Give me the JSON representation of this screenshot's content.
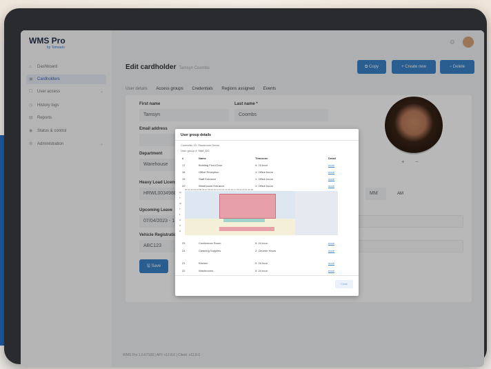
{
  "app": {
    "logo": "WMS Pro",
    "logo_sub": "by Tomaato"
  },
  "sidebar": {
    "collapse": "«",
    "items": [
      {
        "label": "Dashboard",
        "icon": "home-icon"
      },
      {
        "label": "Cardholders",
        "icon": "cardholder-icon"
      },
      {
        "label": "User access",
        "icon": "user-access-icon"
      },
      {
        "label": "History logs",
        "icon": "history-icon"
      },
      {
        "label": "Reports",
        "icon": "reports-icon"
      },
      {
        "label": "Status & control",
        "icon": "status-icon"
      },
      {
        "label": "Administration",
        "icon": "admin-icon"
      }
    ]
  },
  "header": {
    "title": "Edit cardholder",
    "subtitle": "Tamsyn Coombs",
    "copy": "Copy",
    "create": "+ Create new",
    "delete": "− Delete"
  },
  "tabs": [
    "User details",
    "Access groups",
    "Credentials",
    "Regions assigned",
    "Events"
  ],
  "form": {
    "first_name_label": "First name",
    "first_name": "Tamsyn",
    "last_name_label": "Last name *",
    "last_name": "Coombs",
    "email_label": "Email address",
    "department_label": "Department",
    "department": "Warehouse",
    "license_label": "Heavy Load Licens",
    "license": "HRWL0034988",
    "leave_label": "Upcoming Leave",
    "leave": "07/04/2023 - 1",
    "vehicle_label": "Vehicle Registratio",
    "vehicle": "ABC123",
    "time_mm": "MM",
    "time_ampm": "AM",
    "save": "Save",
    "plus": "+",
    "minus": "−"
  },
  "footer": "WMS Pro 1.0.67109 | API: v12.8.0 | Client: v12.8.0",
  "modal": {
    "title": "User group details",
    "controller": "Controller 10: Showroom Demo",
    "user_group": "User group 4: Staff_DG",
    "headers": [
      "#",
      "Name",
      "Timezone",
      "Detail"
    ],
    "rows_top": [
      {
        "n": "17",
        "name": "Building Front Door",
        "tz": "0: 24 hour",
        "d": "more"
      },
      {
        "n": "18",
        "name": "Office Reception",
        "tz": "1: Office hours",
        "d": "more"
      },
      {
        "n": "19",
        "name": "Staff Entrance",
        "tz": "1: Office hours",
        "d": "more"
      },
      {
        "n": "20",
        "name": "Warehouse Entrance",
        "tz": "1: Office hours",
        "d": "more"
      }
    ],
    "rows_bottom": [
      {
        "n": "21",
        "name": "Kitchen",
        "tz": "0: 24 hour",
        "d": "more"
      },
      {
        "n": "22",
        "name": "Washrooms",
        "tz": "0: 24 hour",
        "d": "more"
      },
      {
        "n": "23",
        "name": "Conference Room",
        "tz": "0: 24 hour",
        "d": "more"
      },
      {
        "n": "24",
        "name": "Cleaning Supplies",
        "tz": "2: Cleaner Hours",
        "d": "more"
      }
    ],
    "grid_header": "00 01 02 03 04 05 06 07 08 09 10 11 12 13 14 15 16 17 18 19 20 21 22 23",
    "grid_days": [
      "M",
      "T",
      "W",
      "T",
      "F",
      "S",
      "S",
      "H"
    ],
    "close": "Close"
  },
  "colors": {
    "accent": "#3b82c8",
    "blue_band": "#1d5ea8",
    "schedule_red": "#e8a0a8",
    "schedule_teal": "#9fd4c8"
  }
}
